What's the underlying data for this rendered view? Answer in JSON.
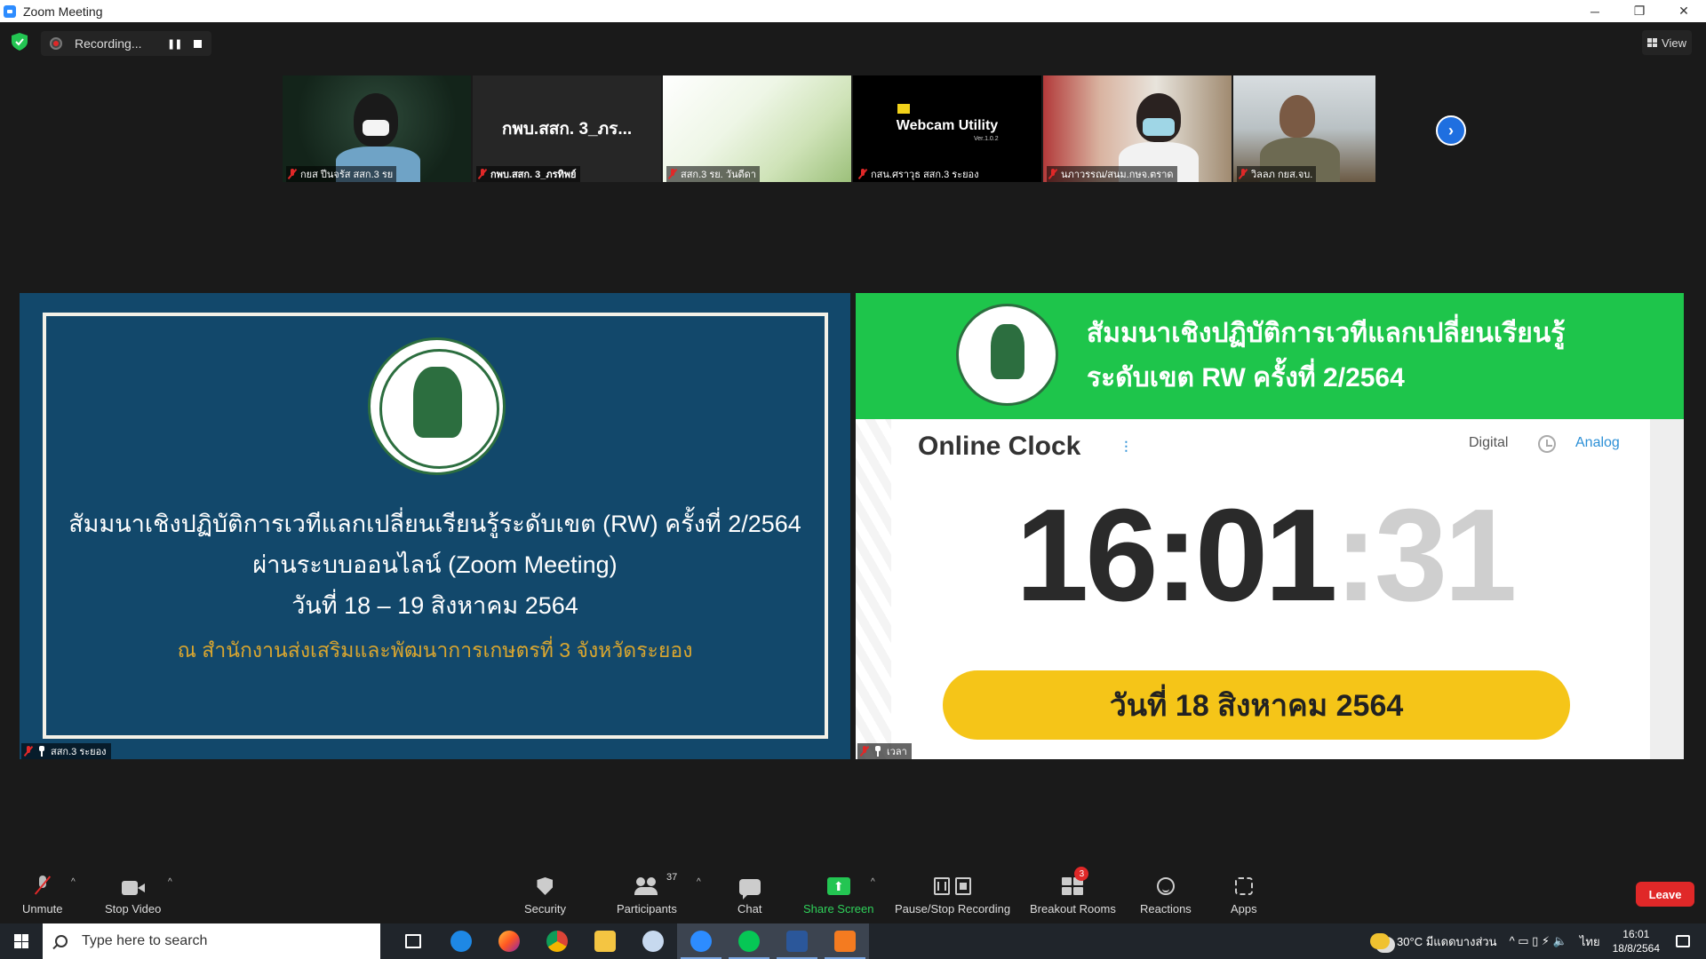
{
  "window": {
    "title": "Zoom Meeting",
    "minimize": "─",
    "restore": "❐",
    "close": "✕"
  },
  "topbar": {
    "recording_label": "Recording...",
    "pause_glyph": "❚❚",
    "view_label": "View"
  },
  "participants_strip": [
    {
      "name": "กยส ปีนจรัส สสก.3 รย"
    },
    {
      "name": "กพบ.สสก. 3_ภรทิพย์",
      "display": "กพบ.สสก. 3_ภร..."
    },
    {
      "name": "สสก.3 รย. วันดีดา"
    },
    {
      "name": "กสน.ศราวุธ สสก.3 ระยอง",
      "webcam_text": "Webcam Utility",
      "webcam_version": "Ver.1.0.2"
    },
    {
      "name": "นภาวรรณ/สนม.กษจ.ตราด"
    },
    {
      "name": "วิลลภ กยส.จบ."
    }
  ],
  "next_glyph": "›",
  "share_left": {
    "line1": "สัมมนาเชิงปฏิบัติการเวทีแลกเปลี่ยนเรียนรู้ระดับเขต (RW) ครั้งที่ 2/2564",
    "line2": "ผ่านระบบออนไลน์ (Zoom Meeting)",
    "line3": "วันที่ 18 – 19 สิงหาคม 2564",
    "line4": "ณ สำนักงานส่งเสริมและพัฒนาการเกษตรที่ 3 จังหวัดระยอง",
    "participant": "สสก.3 ระยอง"
  },
  "share_right": {
    "banner_line1": "สัมมนาเชิงปฏิบัติการเวทีแลกเปลี่ยนเรียนรู้",
    "banner_line2": "ระดับเขต RW ครั้งที่ 2/2564",
    "clock_title": "Online Clock",
    "sliders_glyph": "⫶",
    "digital_label": "Digital",
    "analog_label": "Analog",
    "time_hm": "16:01",
    "time_sec": ":31",
    "date_label": "วันที่ 18 สิงหาคม 2564",
    "participant": "เวลา"
  },
  "toolbar": {
    "unmute": "Unmute",
    "stop_video": "Stop Video",
    "security": "Security",
    "participants": "Participants",
    "participants_count": "37",
    "chat": "Chat",
    "share_screen": "Share Screen",
    "share_glyph": "⬆",
    "pause_stop": "Pause/Stop Recording",
    "breakout": "Breakout Rooms",
    "breakout_badge": "3",
    "reactions": "Reactions",
    "apps": "Apps",
    "leave": "Leave",
    "caret": "^"
  },
  "taskbar": {
    "search_placeholder": "Type here to search",
    "weather": "30°C มีแดดบางส่วน",
    "tray_glyphs": "^ ▭ ▯ ⚡ 🔈",
    "lang": "ไทย",
    "time": "16:01",
    "date": "18/8/2564"
  },
  "colors": {
    "accent": "#2d8cff",
    "leave": "#e02828",
    "share_green": "#23c552",
    "slide_blue": "#12486b",
    "banner_green": "#1ec54b",
    "date_yellow": "#f5c518"
  }
}
